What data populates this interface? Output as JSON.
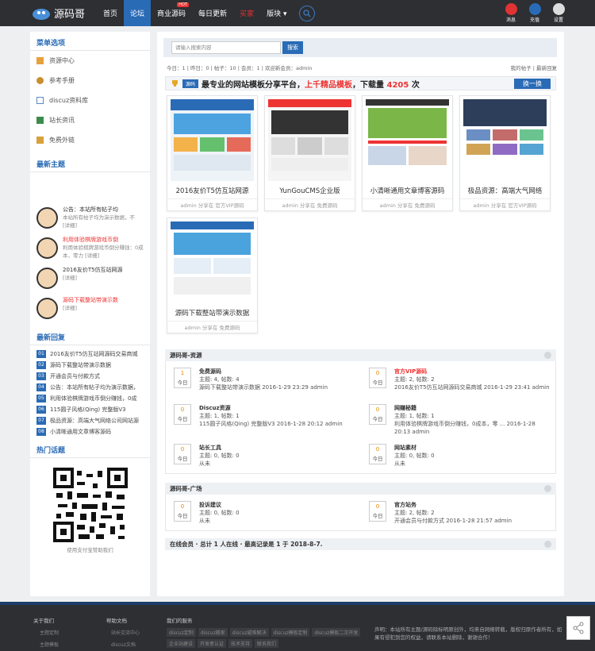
{
  "topbar": {
    "logo": "源码哥",
    "nav": [
      {
        "label": "首页",
        "active": false
      },
      {
        "label": "论坛",
        "active": true
      },
      {
        "label": "商业源码",
        "active": false,
        "badge": "HOT"
      },
      {
        "label": "每日更新",
        "active": false
      },
      {
        "label": "买家",
        "active": false,
        "red": true
      },
      {
        "label": "版块 ▾",
        "active": false
      }
    ],
    "icons": [
      {
        "name": "消息",
        "color": "#e03333"
      },
      {
        "name": "充值",
        "color": "#2a6bb6"
      },
      {
        "name": "设置",
        "color": "#dddddd"
      }
    ]
  },
  "sidebar": {
    "menu_title": "菜单选项",
    "menu": [
      {
        "label": "资源中心",
        "color": "#e7a03b"
      },
      {
        "label": "参考手册",
        "color": "#c98f2e"
      },
      {
        "label": "discuz资料库",
        "color": "#5a88c6"
      },
      {
        "label": "站长资讯",
        "color": "#3b8c4b"
      },
      {
        "label": "免费外链",
        "color": "#d8a13b"
      }
    ],
    "latest_title": "最新主题",
    "latest": [
      {
        "title": "公告：本站所有帖子均",
        "desc": "本站所有帖子均为演示数据，不 [详细]",
        "red": false
      },
      {
        "title": "利用体验棋牌游戏币倒",
        "desc": "利用体验棋牌游戏币倒分赚钱：0成本，零力 [详细]",
        "red": true
      },
      {
        "title": "2016友价T5仿互站网源",
        "desc": "[详细]",
        "red": false
      },
      {
        "title": "源码下载整站带演示数",
        "desc": "[详细]",
        "red": true
      }
    ],
    "reply_title": "最新回复",
    "replies": [
      {
        "num": "01",
        "text": "2016友价T5仿互站网源码交易商城"
      },
      {
        "num": "02",
        "text": "源码下载整站带演示数据"
      },
      {
        "num": "03",
        "text": "开通会员与付款方式"
      },
      {
        "num": "04",
        "text": "公告：本站所有帖子均为演示数据，"
      },
      {
        "num": "05",
        "text": "利用体验棋牌游戏币倒分赚钱，0成"
      },
      {
        "num": "06",
        "text": "115圆子风格(Qing) 完整版V3"
      },
      {
        "num": "07",
        "text": "极品资源：高端大气网络公司网站源"
      },
      {
        "num": "08",
        "text": "小清晰通用文章博客源码"
      }
    ],
    "hot_title": "热门话题",
    "qr_caption": "使用支付宝赞助我们"
  },
  "main": {
    "search": {
      "placeholder": "请输入搜索内容",
      "button": "搜索"
    },
    "stats": {
      "left": "今日：1  |  昨日：0  |  帖子：10  |  会员：1  |  欢迎新会员：admin",
      "right": "我的帖子  |  最新回复"
    },
    "banner": {
      "badge": "源码",
      "text": "最专业的网站模板分享平台，",
      "red": "上千精品模板",
      "text2": "，下载量",
      "count": "4205",
      "text3": " 次",
      "button": "换一换"
    },
    "cards": [
      {
        "title": "2016友价T5仿互站网源",
        "meta": "admin 分享在 官方VIP源码"
      },
      {
        "title": "YunGouCMS企业版",
        "meta": "admin 分享在 免费源码"
      },
      {
        "title": "小清晰通用文章博客源码",
        "meta": "admin 分享在 免费源码"
      },
      {
        "title": "极品资源：高端大气网络",
        "meta": "admin 分享在 官方VIP源码"
      },
      {
        "title": "源码下载整站带演示数据",
        "meta": "admin 分享在 免费源码"
      }
    ],
    "section1": {
      "title": "源码哥-资源",
      "forums": [
        {
          "name": "免费源码",
          "count": "1",
          "stat": "主题: 4, 帖数: 4",
          "last": "源码下载整站带演示数据 2016-1-29 23:29 admin",
          "red": false
        },
        {
          "name": "官方VIP源码",
          "count": "0",
          "stat": "主题: 2, 帖数: 2",
          "last": "2016友价T5仿互站网源码交易商城 2016-1-29 23:41 admin",
          "red": true
        },
        {
          "name": "Discuz资源",
          "count": "0",
          "stat": "主题: 1, 帖数: 1",
          "last": "115圆子风格(Qing) 完整版V3 2016-1-28 20:12 admin",
          "red": false
        },
        {
          "name": "网赚秘籍",
          "count": "0",
          "stat": "主题: 1, 帖数: 1",
          "last": "利用体验棋牌游戏币倒分赚钱，0成本，零 ... 2016-1-28",
          "last2": "20:13 admin",
          "red": false
        },
        {
          "name": "站长工具",
          "count": "0",
          "stat": "主题: 0, 帖数: 0",
          "last": "从未",
          "red": false
        },
        {
          "name": "网站素材",
          "count": "0",
          "stat": "主题: 0, 帖数: 0",
          "last": "从未",
          "red": false
        }
      ]
    },
    "section2": {
      "title": "源码哥-广场",
      "forums": [
        {
          "name": "投诉建议",
          "count": "0",
          "stat": "主题: 0, 帖数: 0",
          "last": "从未",
          "red": false
        },
        {
          "name": "官方站务",
          "count": "0",
          "stat": "主题: 2, 帖数: 2",
          "last": "开通会员与付款方式 2016-1-28 21:57 admin",
          "red": false
        }
      ]
    },
    "online": "在线会员 · 总计 1 人在线 · 最高记录是 1 于 2018-8-7.",
    "today_label": "今日"
  },
  "footer": {
    "col1": {
      "title": "关于我们",
      "links": [
        "主题定制",
        "主题模板"
      ]
    },
    "col2": {
      "title": "帮助文档",
      "links": [
        "站长交流中心",
        "discuz文档"
      ]
    },
    "col3": {
      "title": "我们的服务",
      "tags": [
        "discuz定制",
        "discuz搬家",
        "discuz疑难解决",
        "discuz模板定制",
        "discuz模板二次开发",
        "企业站建设",
        "开发者认证",
        "技术支持",
        "联系我们"
      ]
    },
    "notice": "声明：本站所有主题/源码除标明原创外，均来自网络转载，版权归原作者所有，如果有侵犯到您的权益，请联系本站删除，谢谢合作！"
  }
}
